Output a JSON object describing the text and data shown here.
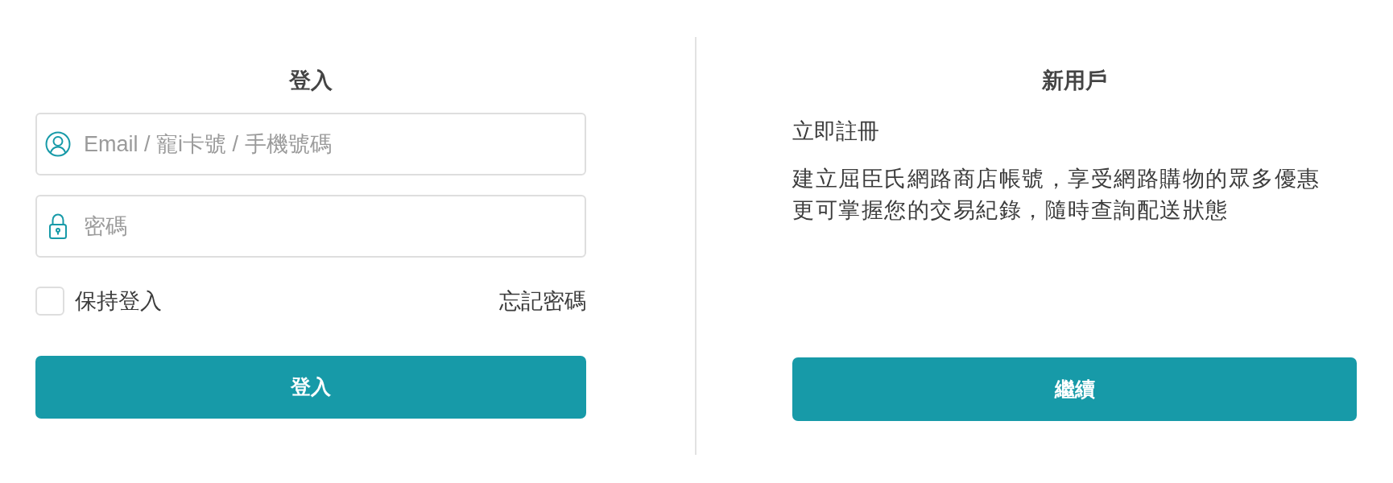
{
  "login": {
    "title": "登入",
    "fields": [
      {
        "kind": "account",
        "placeholder": "Email / 寵i卡號 / 手機號碼"
      },
      {
        "kind": "password",
        "placeholder": "密碼"
      }
    ],
    "remember": {
      "label": "保持登入",
      "checked": false
    },
    "forgot_link": "忘記密碼",
    "submit": "登入"
  },
  "register": {
    "title": "新用戶",
    "subtitle": "立即註冊",
    "description": [
      "建立屈臣氏網路商店帳號，享受網路購物的眾多優惠",
      "更可掌握您的交易紀錄，隨時查詢配送狀態"
    ],
    "button": "繼續"
  }
}
